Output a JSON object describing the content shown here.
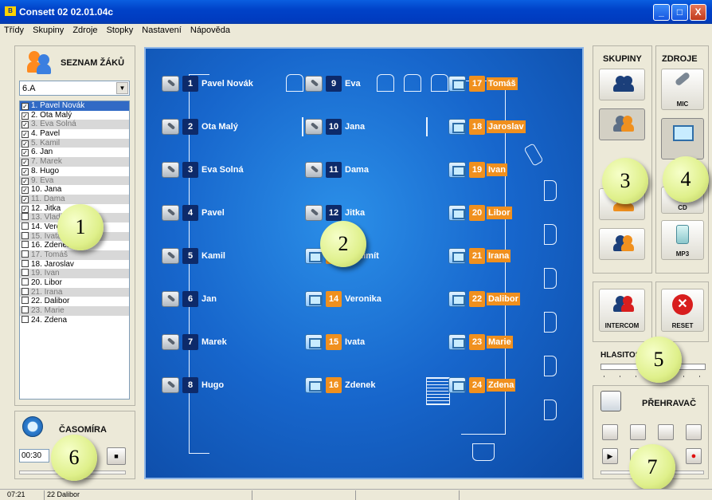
{
  "window": {
    "title": "Consett 02 02.01.04c",
    "icon_text": "B",
    "btn_min": "_",
    "btn_max": "□",
    "btn_close": "X"
  },
  "menu": [
    "Třídy",
    "Skupiny",
    "Zdroje",
    "Stopky",
    "Nastavení",
    "Nápověda"
  ],
  "students_panel": {
    "title": "SEZNAM ŽÁKŮ",
    "class_selected": "6.A",
    "dropdown_arrow": "▼",
    "items": [
      {
        "label": "1. Pavel Novák",
        "checked": true,
        "state": "selected"
      },
      {
        "label": "2. Ota Malý",
        "checked": true,
        "state": "normal"
      },
      {
        "label": "3. Eva Solná",
        "checked": true,
        "state": "gray"
      },
      {
        "label": "4. Pavel",
        "checked": true,
        "state": "normal"
      },
      {
        "label": "5. Kamil",
        "checked": true,
        "state": "gray"
      },
      {
        "label": "6. Jan",
        "checked": true,
        "state": "normal"
      },
      {
        "label": "7. Marek",
        "checked": true,
        "state": "gray"
      },
      {
        "label": "8. Hugo",
        "checked": true,
        "state": "normal"
      },
      {
        "label": "9. Eva",
        "checked": true,
        "state": "gray"
      },
      {
        "label": "10. Jana",
        "checked": true,
        "state": "normal"
      },
      {
        "label": "11. Dama",
        "checked": true,
        "state": "gray"
      },
      {
        "label": "12. Jitka",
        "checked": true,
        "state": "normal"
      },
      {
        "label": "13. Vladimít",
        "checked": false,
        "state": "gray"
      },
      {
        "label": "14. Veronika",
        "checked": false,
        "state": "normal"
      },
      {
        "label": "15. Ivata",
        "checked": false,
        "state": "gray"
      },
      {
        "label": "16. Zdenek",
        "checked": false,
        "state": "normal"
      },
      {
        "label": "17. Tomáš",
        "checked": false,
        "state": "gray"
      },
      {
        "label": "18. Jaroslav",
        "checked": false,
        "state": "normal"
      },
      {
        "label": "19. Ivan",
        "checked": false,
        "state": "gray"
      },
      {
        "label": "20. Libor",
        "checked": false,
        "state": "normal"
      },
      {
        "label": "21. Irana",
        "checked": false,
        "state": "gray"
      },
      {
        "label": "22. Dalibor",
        "checked": false,
        "state": "normal"
      },
      {
        "label": "23. Marie",
        "checked": false,
        "state": "gray"
      },
      {
        "label": "24. Zdena",
        "checked": false,
        "state": "normal"
      }
    ]
  },
  "stopwatch": {
    "title": "ČASOMÍRA",
    "time": "00:30",
    "stop_symbol": "■"
  },
  "classroom": {
    "seats": [
      {
        "n": "1",
        "name": "Pavel Novák",
        "type": "mic"
      },
      {
        "n": "2",
        "name": "Ota Malý",
        "type": "mic"
      },
      {
        "n": "3",
        "name": "Eva Solná",
        "type": "mic"
      },
      {
        "n": "4",
        "name": "Pavel",
        "type": "mic"
      },
      {
        "n": "5",
        "name": "Kamil",
        "type": "mic"
      },
      {
        "n": "6",
        "name": "Jan",
        "type": "mic"
      },
      {
        "n": "7",
        "name": "Marek",
        "type": "mic"
      },
      {
        "n": "8",
        "name": "Hugo",
        "type": "mic"
      },
      {
        "n": "9",
        "name": "Eva",
        "type": "mic"
      },
      {
        "n": "10",
        "name": "Jana",
        "type": "mic"
      },
      {
        "n": "11",
        "name": "Dama",
        "type": "mic"
      },
      {
        "n": "12",
        "name": "Jitka",
        "type": "mic"
      },
      {
        "n": "13",
        "name": "Vladimít",
        "type": "comp"
      },
      {
        "n": "14",
        "name": "Veronika",
        "type": "comp"
      },
      {
        "n": "15",
        "name": "Ivata",
        "type": "comp"
      },
      {
        "n": "16",
        "name": "Zdenek",
        "type": "comp"
      },
      {
        "n": "17",
        "name": "Tomáš",
        "type": "comp"
      },
      {
        "n": "18",
        "name": "Jaroslav",
        "type": "comp"
      },
      {
        "n": "19",
        "name": "Ivan",
        "type": "comp"
      },
      {
        "n": "20",
        "name": "Libor",
        "type": "comp"
      },
      {
        "n": "21",
        "name": "Irana",
        "type": "comp"
      },
      {
        "n": "22",
        "name": "Dalibor",
        "type": "comp"
      },
      {
        "n": "23",
        "name": "Marie",
        "type": "comp"
      },
      {
        "n": "24",
        "name": "Zdena",
        "type": "comp"
      }
    ]
  },
  "groups": {
    "title": "SKUPINY"
  },
  "sources": {
    "title": "ZDROJE",
    "mic": "MIC",
    "cd": "CD",
    "mp3": "MP3"
  },
  "intercom": {
    "label": "INTERCOM"
  },
  "reset": {
    "label": "RESET",
    "symbol": "✕"
  },
  "volume": {
    "label": "HLASITOST"
  },
  "player": {
    "title": "PŘEHRAVAČ",
    "play_symbol": "▶",
    "rec_symbol": "●"
  },
  "callouts": [
    "1",
    "2",
    "3",
    "4",
    "5",
    "6",
    "7"
  ],
  "status": {
    "time": "07:21",
    "student": "22 Dalibor"
  },
  "colors": {
    "titlebar": "#0042c8",
    "seat_dark": "#0d2a6a",
    "seat_orange": "#f0901e",
    "classroom": "#1766cc",
    "callout": "#dff08b"
  }
}
